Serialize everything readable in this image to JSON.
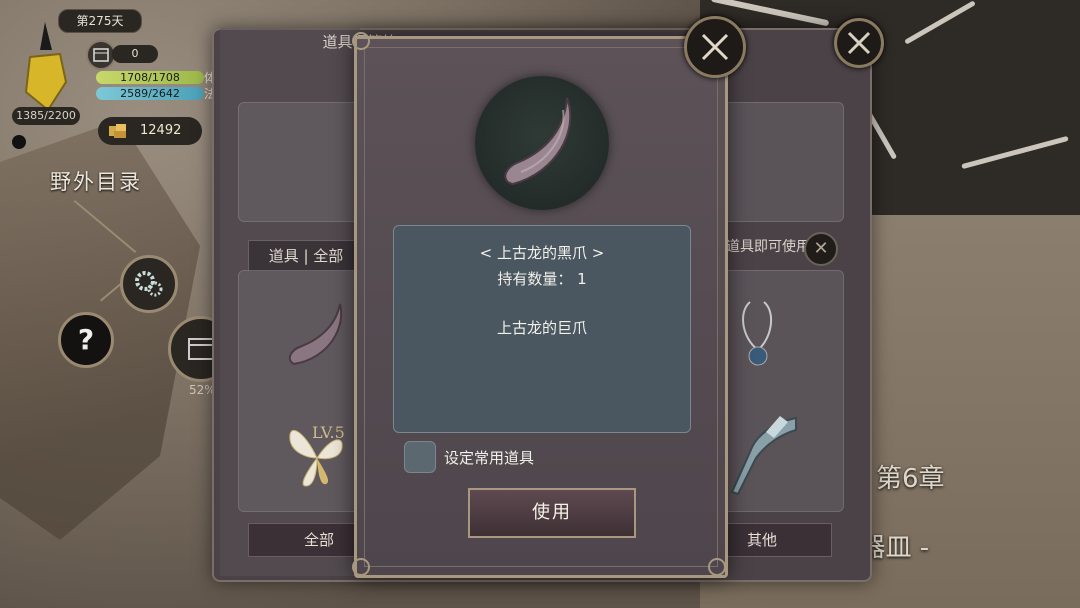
{
  "hud": {
    "day": "第275天",
    "crystal_value": "1385/2200",
    "calendar_count": "0",
    "hp": "1708/1708",
    "hp_tail": "体",
    "mp": "2589/2642",
    "mp_tail": "法",
    "gold": "12492",
    "area_title": "野外目录",
    "progress": "52%"
  },
  "map": {
    "chapter": "第6章",
    "chapter_sub": "h器皿 -"
  },
  "storage": {
    "title": "道具保管箱",
    "item_header": "道具 | 全部",
    "filter_label": "道具即可使用",
    "tabs": [
      "全部",
      "其他"
    ],
    "lv_label": "LV.5"
  },
  "modal": {
    "item_name": "< 上古龙的黑爪 >",
    "item_count": "持有数量： 1",
    "item_desc": "上古龙的巨爪",
    "favorite_label": "设定常用道具",
    "use_label": "使用"
  },
  "colors": {
    "accent_gold": "#a89880",
    "desc_bg": "#4a5660",
    "hp_bar": "#b4c85a",
    "mp_bar": "#62b4c8"
  },
  "icons": [
    "crystal-icon",
    "calendar-icon",
    "gold-coin-icon",
    "gear-icon",
    "help-icon",
    "close-icon",
    "dragon-claw-icon",
    "fairy-wing-icon",
    "amulet-icon",
    "scythe-icon"
  ]
}
